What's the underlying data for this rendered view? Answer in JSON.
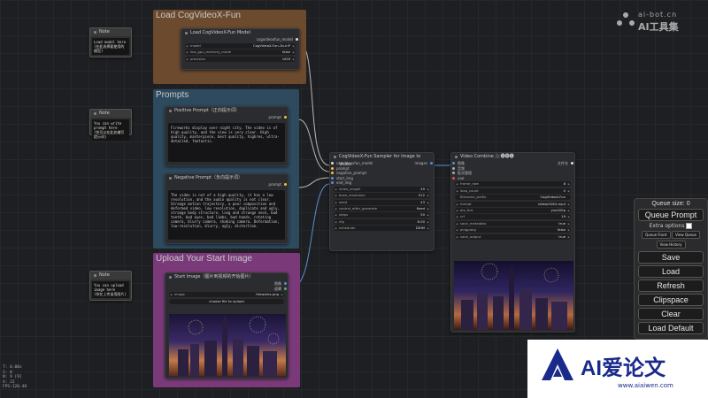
{
  "groups": {
    "load": {
      "title": "Load CogVideoX-Fun",
      "color": "#6b4a2e"
    },
    "prompts": {
      "title": "Prompts",
      "color": "#2d4a5e"
    },
    "upload": {
      "title": "Upload Your Start Image",
      "color": "#7a3a7a"
    }
  },
  "notes": [
    {
      "title": "Note",
      "text": "Load model here\n(在此选择要使用的模型)"
    },
    {
      "title": "Note",
      "text": "You can write prompt here\n(你可以在此处编写提示词)"
    },
    {
      "title": "Note",
      "text": "You can upload image here\n(你在上传该用图片)"
    }
  ],
  "loader": {
    "title": "Load CogVideoX-Fun Model",
    "output": "cogvideoxfun_model",
    "widgets": [
      {
        "label": "model",
        "value": "CogVideoX-Fun-2b-InP"
      },
      {
        "label": "low_gpu_memory_mode",
        "value": "false"
      },
      {
        "label": "precision",
        "value": "bf16"
      }
    ]
  },
  "positive": {
    "title": "Positive Prompt（正向提示词）",
    "output": "prompt",
    "text": "Fireworks display over night city. The video is of high quality, and the view is very clear. High quality, masterpiece, best quality, highres, ultra-detailed, fantastic."
  },
  "negative": {
    "title": "Negative Prompt（负向提示词）",
    "output": "prompt",
    "text": "The video is not of a high quality, it has a low resolution, and the audio quality is not clear. Strange motion trajectory, a poor composition and deformed video, low resolution, duplicate and ugly, strange body structure, long and strange neck, bad teeth, bad eyes, bad limbs, bad hands, rotating camera, blurry camera, shaking camera. Deformation, low-resolution, blurry, ugly, distortion."
  },
  "start_image": {
    "title": "Start Image（图片到视频的开始图片）",
    "outputs": [
      "图像",
      "遮罩"
    ],
    "widget": {
      "label": "image",
      "value": "fireworks.png"
    },
    "upload_label": "choose file to upload"
  },
  "sampler": {
    "title": "CogVideoX-Fun Sampler for Image to Video",
    "inputs": [
      "cogvideoxfun_model",
      "prompt",
      "negative_prompt",
      "start_img",
      "end_img"
    ],
    "output": "images",
    "widgets": [
      {
        "label": "video_length",
        "value": "49"
      },
      {
        "label": "base_resolution",
        "value": "512"
      },
      {
        "label": "seed",
        "value": "43"
      },
      {
        "label": "control_after_generate",
        "value": "fixed"
      },
      {
        "label": "steps",
        "value": "50"
      },
      {
        "label": "cfg",
        "value": "6.00"
      },
      {
        "label": "scheduler",
        "value": "DDIM"
      }
    ]
  },
  "combine": {
    "title": "Video Combine 🎥🅥🅗🅢",
    "output": "文件名",
    "inputs": [
      "图像",
      "音频",
      "批次管理",
      "vae"
    ],
    "widgets": [
      {
        "label": "frame_rate",
        "value": "8"
      },
      {
        "label": "loop_count",
        "value": "0"
      },
      {
        "label": "filename_prefix",
        "value": "CogVideoX-Fun"
      },
      {
        "label": "format",
        "value": "video/h264-mp4"
      },
      {
        "label": "pix_fmt",
        "value": "yuv420p"
      },
      {
        "label": "crf",
        "value": "19"
      },
      {
        "label": "save_metadata",
        "value": "true"
      },
      {
        "label": "pingpong",
        "value": "false"
      },
      {
        "label": "save_output",
        "value": "true"
      }
    ]
  },
  "queue_panel": {
    "queue_size": "Queue size: 0",
    "queue_prompt": "Queue Prompt",
    "extra_options": "Extra options",
    "queue_front": "Queue Front",
    "view_queue": "View Queue",
    "view_history": "View History",
    "buttons": [
      "Save",
      "Load",
      "Refresh",
      "Clipspace",
      "Clear",
      "Load Default"
    ]
  },
  "stats": [
    "T: 0.00s",
    "I: 0",
    "N: 9 [9]",
    "V: 22",
    "FPS:120.48"
  ],
  "watermark_top": {
    "line1": "ai-bot.cn",
    "line2": "AI工具集"
  },
  "watermark_bottom": {
    "text": "AI爱论文",
    "sub": "www.aiaiwen.com"
  }
}
